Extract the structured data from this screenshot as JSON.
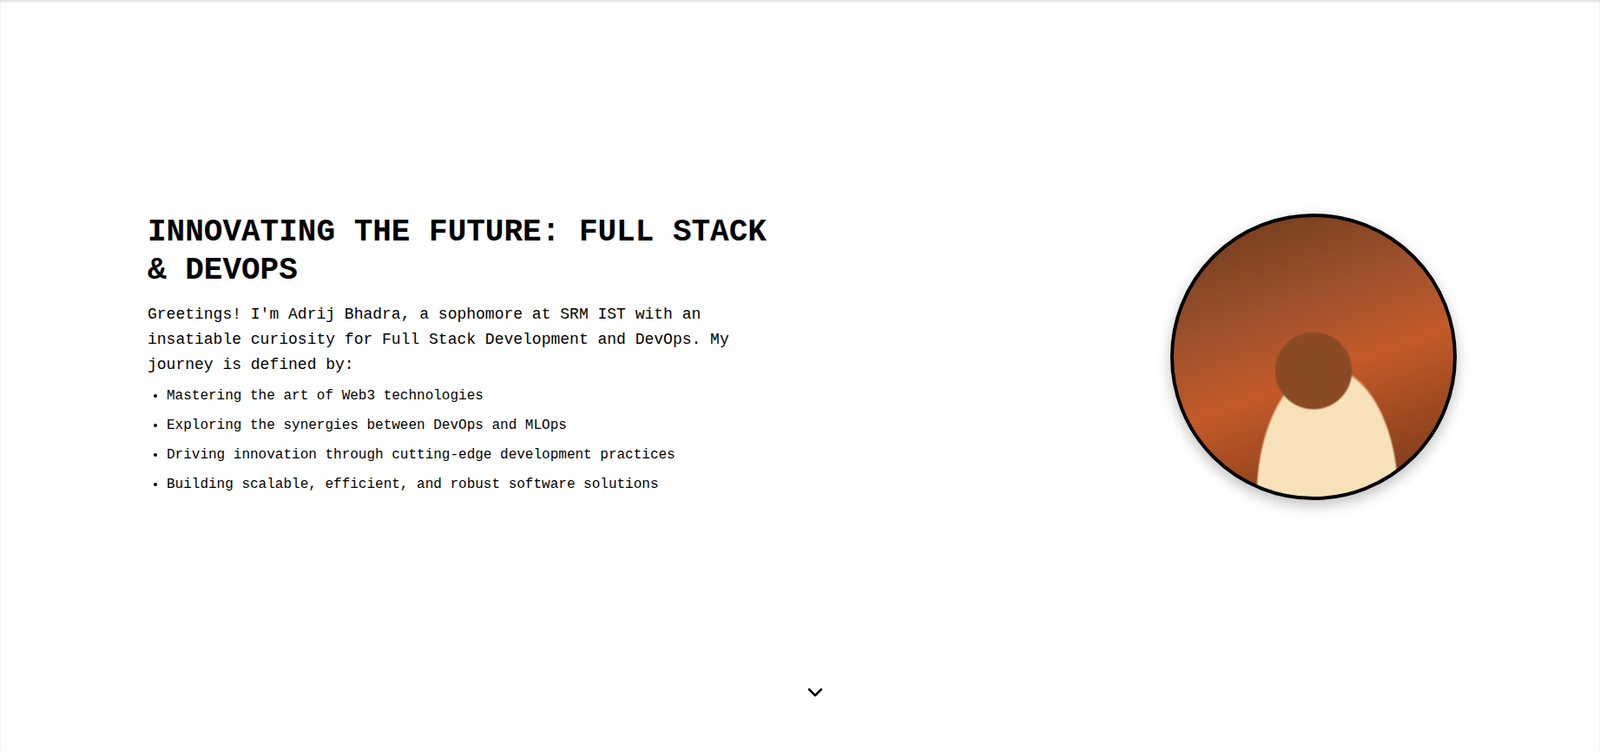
{
  "hero": {
    "title": "INNOVATING THE FUTURE: FULL STACK & DEVOPS",
    "intro": "Greetings! I'm Adrij Bhadra, a sophomore at SRM IST with an insatiable curiosity for Full Stack Development and DevOps. My journey is defined by:",
    "points": [
      "Mastering the art of Web3 technologies",
      "Exploring the synergies between DevOps and MLOps",
      "Driving innovation through cutting-edge development practices",
      "Building scalable, efficient, and robust software solutions"
    ]
  }
}
